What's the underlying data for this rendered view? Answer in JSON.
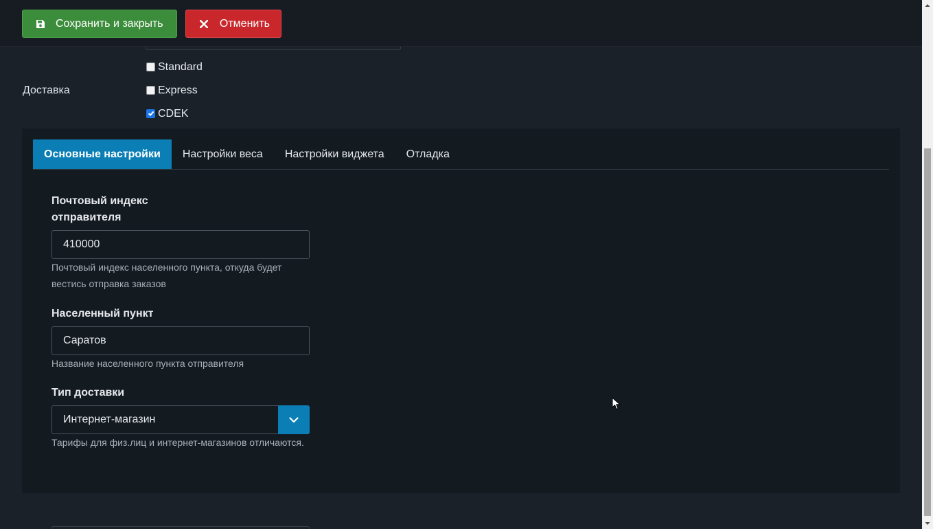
{
  "toolbar": {
    "save_label": "Сохранить и закрыть",
    "save_icon": "save-icon",
    "cancel_label": "Отменить",
    "cancel_icon": "close-icon"
  },
  "delivery": {
    "label": "Доставка",
    "options": [
      {
        "label": "Standard",
        "checked": false
      },
      {
        "label": "Express",
        "checked": false
      },
      {
        "label": "CDEK",
        "checked": true
      }
    ]
  },
  "tabs": [
    {
      "label": "Основные настройки",
      "active": true
    },
    {
      "label": "Настройки веса",
      "active": false
    },
    {
      "label": "Настройки виджета",
      "active": false
    },
    {
      "label": "Отладка",
      "active": false
    }
  ],
  "fields": {
    "postcode": {
      "label_line1": "Почтовый индекс",
      "label_line2": "отправителя",
      "value": "410000",
      "help_line1": "Почтовый индекс населенного пункта, откуда будет",
      "help_line2": "вестись отправка заказов"
    },
    "city": {
      "label": "Населенный пункт",
      "value": "Саратов",
      "help": "Название населенного пункта отправителя"
    },
    "delivery_type": {
      "label": "Тип доставки",
      "value": "Интернет-магазин",
      "help": "Тарифы для физ.лиц и интернет-магазинов отличаются."
    }
  },
  "colors": {
    "save": "#3b8c3b",
    "cancel": "#c9272b",
    "accent": "#0b7fb5",
    "background": "#1a2129",
    "panel": "#131a20"
  }
}
